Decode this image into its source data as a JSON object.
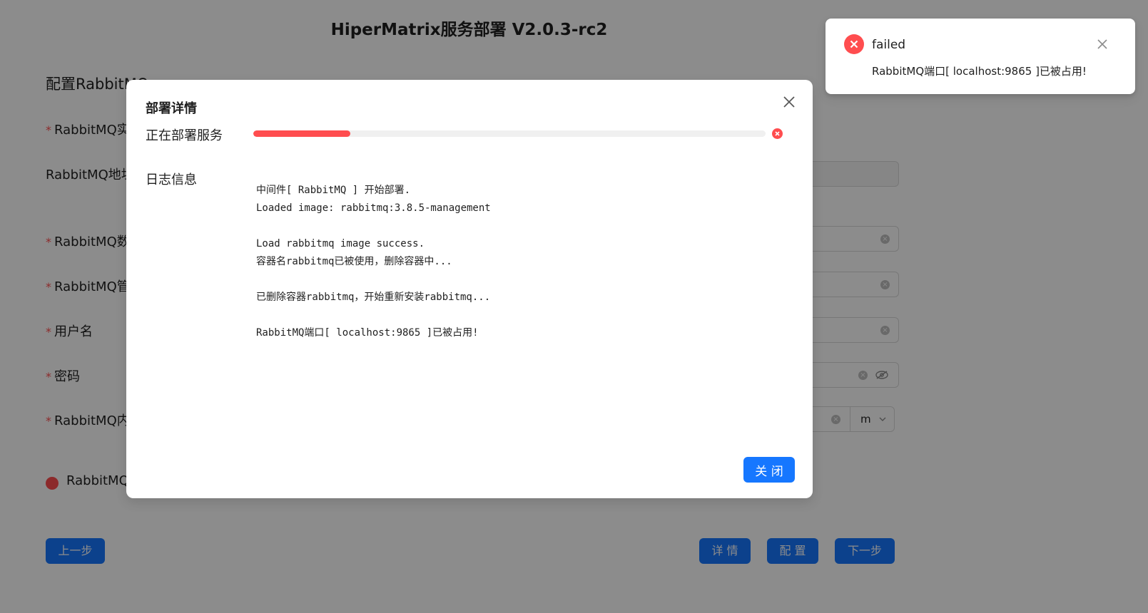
{
  "page": {
    "title": "HiperMatrix服务部署 V2.0.3-rc2",
    "section_title": "配置RabbitMQ",
    "required_mark": "*",
    "fields": [
      {
        "label": "RabbitMQ实",
        "required": true
      },
      {
        "label": "RabbitMQ地址",
        "required": false
      },
      {
        "label": "RabbitMQ数",
        "required": true
      },
      {
        "label": "RabbitMQ管",
        "required": true
      },
      {
        "label": "用户名",
        "required": true
      },
      {
        "label": "密码",
        "required": true
      },
      {
        "label": "RabbitMQ内",
        "required": true
      }
    ],
    "memory_unit": "m",
    "status_label": "RabbitMQ",
    "buttons": {
      "prev": "上一步",
      "details": "详 情",
      "configure": "配 置",
      "next": "下一步"
    }
  },
  "modal": {
    "title": "部署详情",
    "progress_label": "正在部署服务",
    "progress_percent": 19,
    "progress_status": "error",
    "log_label": "日志信息",
    "log_lines": [
      "中间件[ RabbitMQ ] 开始部署.",
      "Loaded image: rabbitmq:3.8.5-management",
      "",
      "Load rabbitmq image success.",
      "容器名rabbitmq已被使用，删除容器中...",
      "",
      "已删除容器rabbitmq，开始重新安装rabbitmq...",
      "",
      "RabbitMQ端口[ localhost:9865 ]已被占用!"
    ],
    "close_button": "关 闭"
  },
  "notification": {
    "title": "failed",
    "description": "RabbitMQ端口[ localhost:9865 ]已被占用!",
    "type": "error"
  },
  "colors": {
    "primary": "#1677ff",
    "error": "#ff4d4f"
  },
  "icons": {
    "modal_close": "close-icon",
    "progress_status": "error-icon",
    "notification_type": "error-icon",
    "notification_close": "close-icon",
    "password_toggle": "eye-invisible-icon",
    "select_arrow": "chevron-down-icon"
  }
}
